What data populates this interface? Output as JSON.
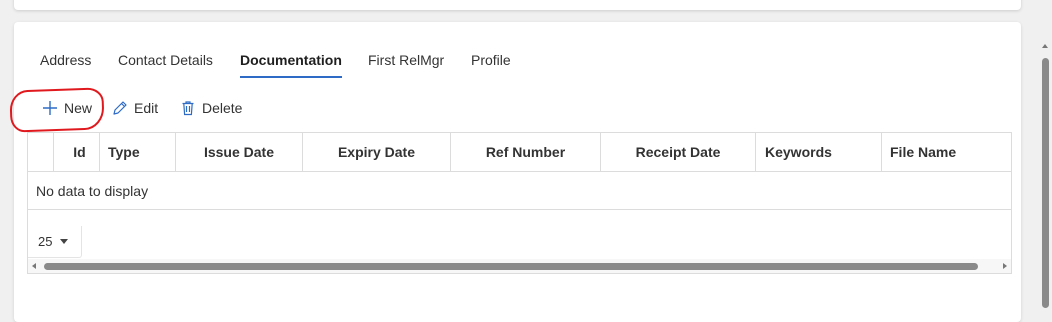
{
  "tabs": [
    {
      "label": "Address",
      "active": false
    },
    {
      "label": "Contact Details",
      "active": false
    },
    {
      "label": "Documentation",
      "active": true
    },
    {
      "label": "First RelMgr",
      "active": false
    },
    {
      "label": "Profile",
      "active": false
    }
  ],
  "toolbar": {
    "new_label": "New",
    "edit_label": "Edit",
    "delete_label": "Delete"
  },
  "grid": {
    "columns": [
      "Id",
      "Type",
      "Issue Date",
      "Expiry Date",
      "Ref Number",
      "Receipt Date",
      "Keywords",
      "File Name"
    ],
    "empty_text": "No data to display",
    "page_size": "25"
  },
  "colors": {
    "accent": "#2e6bc6",
    "annotation": "#e0191e"
  }
}
